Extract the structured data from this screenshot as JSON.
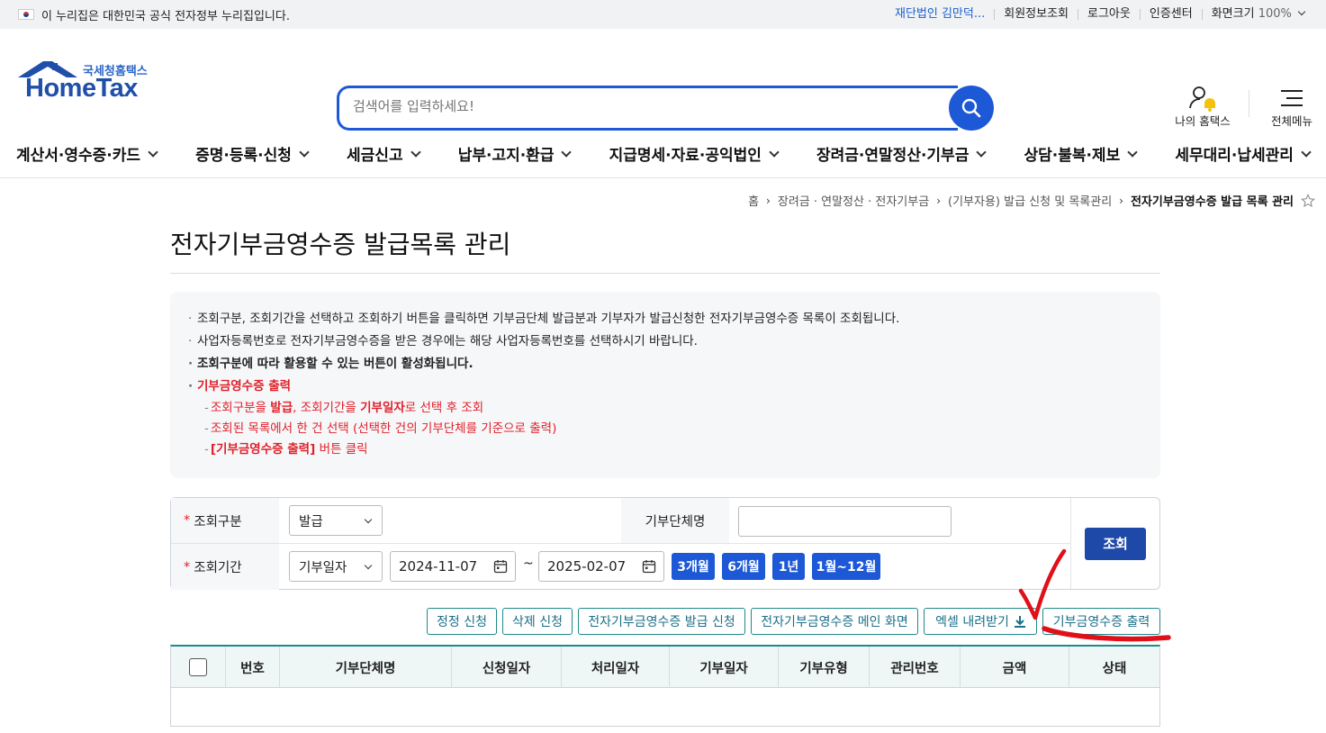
{
  "topbar": {
    "gov_notice": "이 누리집은 대한민국 공식 전자정부 누리집입니다.",
    "user_name": "재단법인 김만덕...",
    "member_info": "회원정보조회",
    "logout": "로그아웃",
    "cert_center": "인증센터",
    "screen_size_label": "화면크기",
    "screen_size_value": "100%"
  },
  "header": {
    "logo_sub": "국세청홈택스",
    "logo_main": "HomeTax",
    "search_placeholder": "검색어를 입력하세요!",
    "my_hometax": "나의 홈택스",
    "all_menu": "전체메뉴"
  },
  "gnb": [
    "계산서·영수증·카드",
    "증명·등록·신청",
    "세금신고",
    "납부·고지·환급",
    "지급명세·자료·공익법인",
    "장려금·연말정산·기부금",
    "상담·불복·제보",
    "세무대리·납세관리"
  ],
  "breadcrumb": {
    "home": "홈",
    "level1": "장려금 · 연말정산 · 전자기부금",
    "level2": "(기부자용) 발급 신청 및 목록관리",
    "current": "전자기부금영수증 발급 목록 관리"
  },
  "page_title": "전자기부금영수증 발급목록 관리",
  "notice": {
    "line1": "조회구분, 조회기간을 선택하고 조회하기 버튼을 클릭하면 기부금단체 발급분과 기부자가 발급신청한 전자기부금영수증 목록이 조회됩니다.",
    "line2": "사업자등록번호로 전자기부금영수증을 받은 경우에는 해당 사업자등록번호를 선택하시기 바랍니다.",
    "line3": "조회구분에 따라 활용할 수 있는 버튼이 활성화됩니다.",
    "line4": "기부금영수증 출력",
    "sub1_a": "조회구분을 ",
    "sub1_b": "발급",
    "sub1_c": ", 조회기간을 ",
    "sub1_d": "기부일자",
    "sub1_e": "로 선택 후 조회",
    "sub2": "조회된 목록에서 한 건 선택 (선택한 건의 기부단체를 기준으로 출력)",
    "sub3_a": "[기부금영수증 출력]",
    "sub3_b": " 버튼 클릭"
  },
  "filter": {
    "req_mark": "*",
    "type_label": "조회구분",
    "type_value": "발급",
    "org_label": "기부단체명",
    "org_value": "",
    "period_label": "조회기간",
    "period_type": "기부일자",
    "start_date": "2024-11-07",
    "tilde": "~",
    "end_date": "2025-02-07",
    "btn_3m": "3개월",
    "btn_6m": "6개월",
    "btn_1y": "1년",
    "btn_1to12": "1월~12월",
    "search_btn": "조회"
  },
  "actions": {
    "correct": "정정 신청",
    "delete": "삭제 신청",
    "issue_request": "전자기부금영수증 발급 신청",
    "main_screen": "전자기부금영수증 메인 화면",
    "excel": "엑셀 내려받기",
    "print": "기부금영수증 출력"
  },
  "grid": {
    "columns": [
      "번호",
      "기부단체명",
      "신청일자",
      "처리일자",
      "기부일자",
      "기부유형",
      "관리번호",
      "금액",
      "상태"
    ]
  },
  "colors": {
    "primary": "#1d58d6",
    "teal": "#1f8a8a",
    "red_mark": "#e0101a"
  }
}
